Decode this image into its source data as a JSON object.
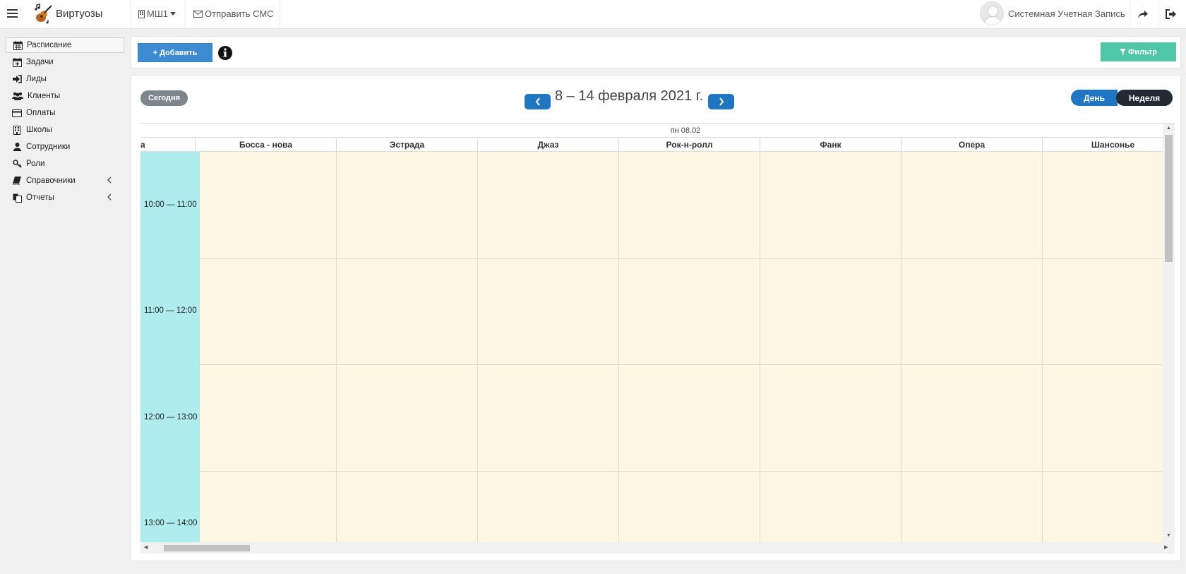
{
  "topbar": {
    "brand": "Виртуозы",
    "school": "МШ1",
    "sms": "Отправить СМС",
    "user": "Системная Учетная Запись"
  },
  "sidebar": {
    "items": [
      {
        "label": "Расписание",
        "icon": "calendar-icon"
      },
      {
        "label": "Задачи",
        "icon": "calendar-plus-icon"
      },
      {
        "label": "Лиды",
        "icon": "sign-in-icon"
      },
      {
        "label": "Клиенты",
        "icon": "users-icon"
      },
      {
        "label": "Оплаты",
        "icon": "credit-card-icon"
      },
      {
        "label": "Школы",
        "icon": "building-icon"
      },
      {
        "label": "Сотрудники",
        "icon": "user-icon"
      },
      {
        "label": "Роли",
        "icon": "key-icon"
      },
      {
        "label": "Справочники",
        "icon": "book-icon"
      },
      {
        "label": "Отчеты",
        "icon": "copy-icon"
      }
    ]
  },
  "actions": {
    "add": "Добавить",
    "filter": "Фильтр"
  },
  "calendar": {
    "today": "Сегодня",
    "range": "8 – 14 февраля 2021 г.",
    "view_day": "День",
    "view_week": "Неделя",
    "day_header": "пн 08.02",
    "partial_column": "а",
    "columns": [
      "Босса - нова",
      "Эстрада",
      "Джаз",
      "Рок-н-ролл",
      "Фанк",
      "Опера",
      "Шансонье"
    ],
    "time_slots": [
      "10:00 — 11:00",
      "11:00 — 12:00",
      "12:00 — 13:00",
      "13:00 — 14:00"
    ]
  },
  "colors": {
    "primary": "#1f77c4",
    "add_button": "#3d8bd0",
    "filter_button": "#4fc7a6",
    "time_column": "#aeeced",
    "slot_background": "#fcf6e3",
    "week_button": "#222a33"
  }
}
